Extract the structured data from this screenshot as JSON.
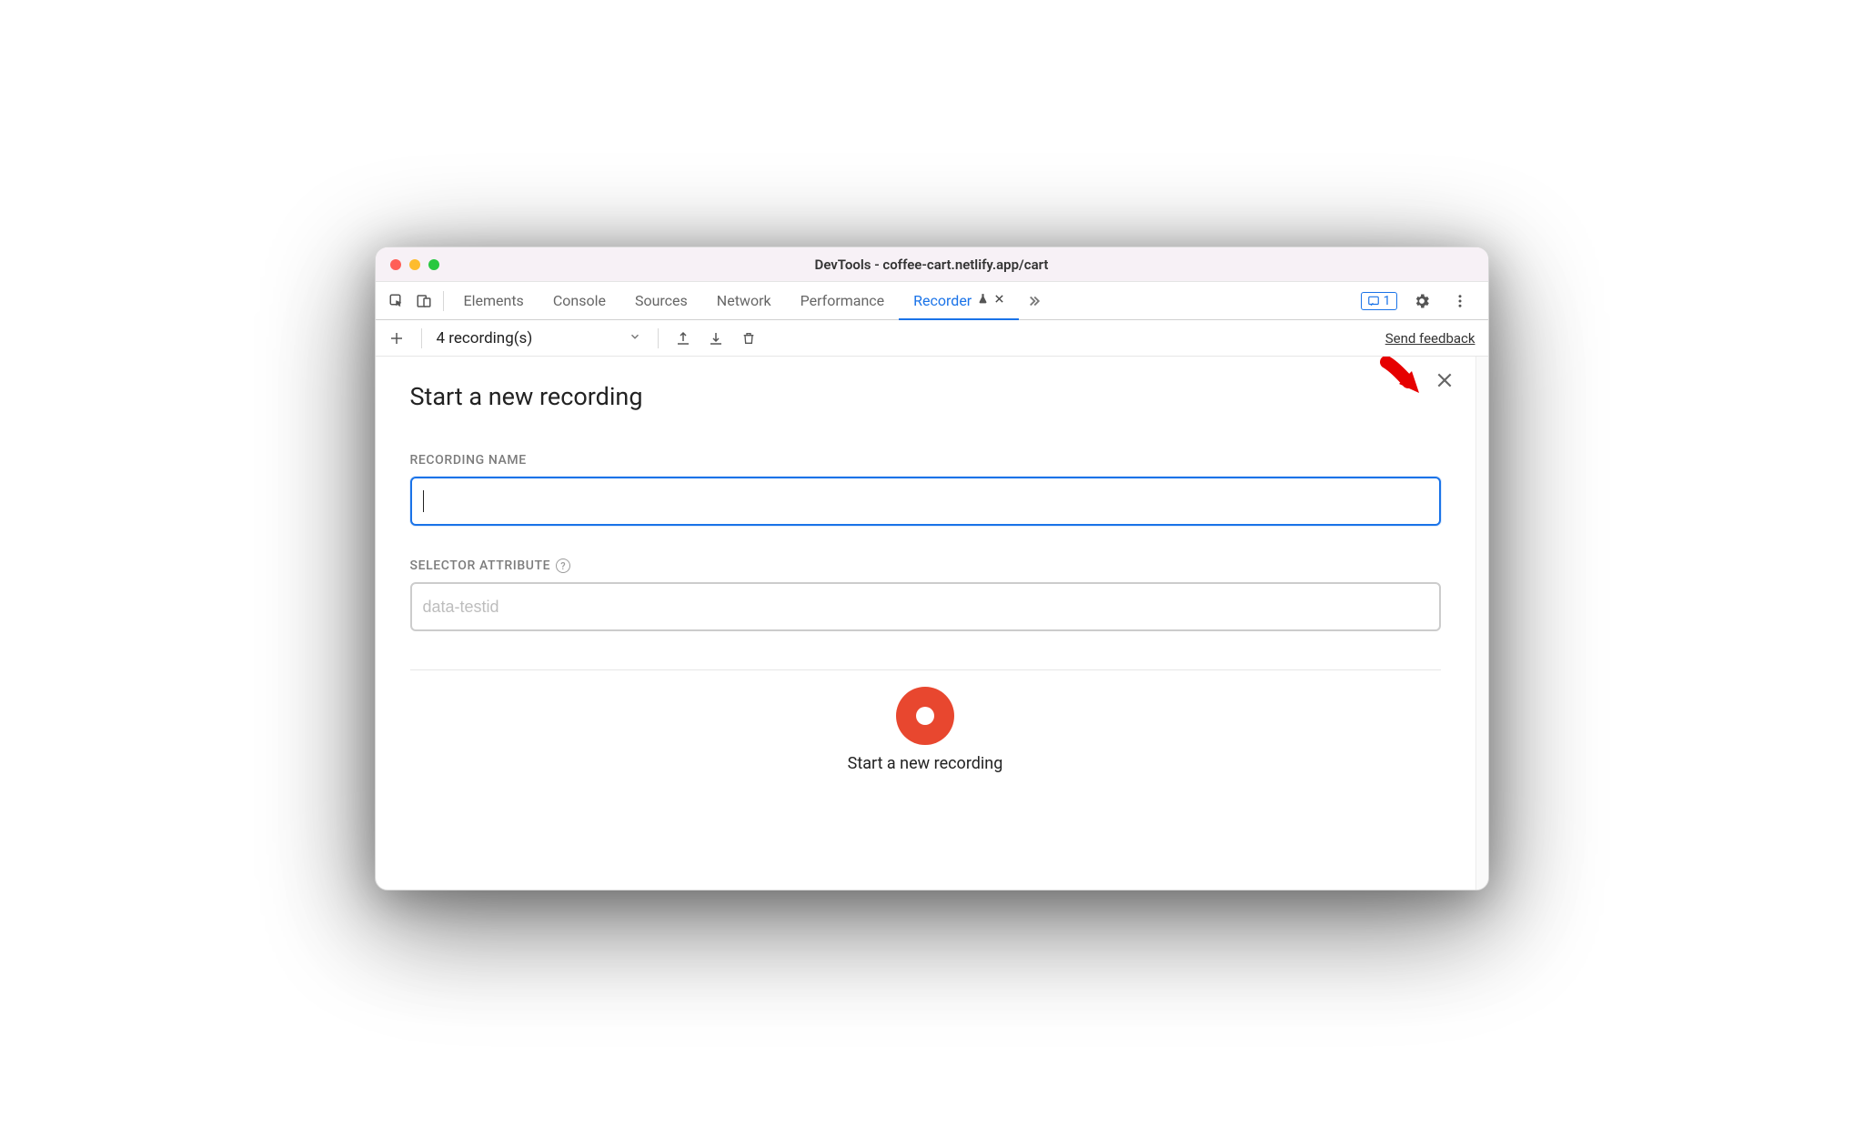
{
  "window": {
    "title": "DevTools - coffee-cart.netlify.app/cart"
  },
  "tabs": {
    "elements": "Elements",
    "console": "Console",
    "sources": "Sources",
    "network": "Network",
    "performance": "Performance",
    "recorder": "Recorder"
  },
  "issues": {
    "count": "1"
  },
  "toolbar": {
    "recording_count": "4 recording(s)",
    "feedback": "Send feedback"
  },
  "page": {
    "heading": "Start a new recording",
    "recording_name_label": "Recording Name",
    "recording_name_value": "",
    "selector_attr_label": "Selector Attribute",
    "selector_attr_placeholder": "data-testid",
    "record_button_label": "Start a new recording"
  }
}
